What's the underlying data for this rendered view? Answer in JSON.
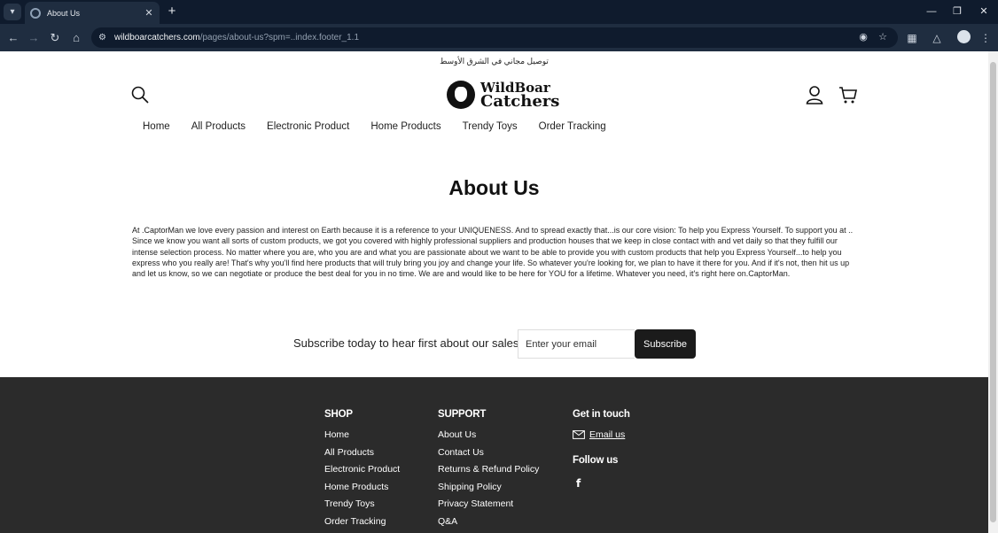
{
  "browser": {
    "tab_title": "About Us",
    "url_host": "wildboarcatchers.com",
    "url_path": "/pages/about-us?spm=..index.footer_1.1"
  },
  "announcement": "توصيل مجاني في الشرق الأوسط",
  "logo": {
    "line1": "WildBoar",
    "line2": "Catchers"
  },
  "nav": {
    "items": [
      "Home",
      "All Products",
      "Electronic Product",
      "Home Products",
      "Trendy Toys",
      "Order Tracking"
    ]
  },
  "page": {
    "title": "About Us",
    "body": "At .CaptorMan we love every passion and interest on Earth because it is a reference to your UNIQUENESS. And to spread exactly that...is our core vision: To help you Express Yourself. To support you at .. Since we know you want all sorts of custom products, we got you covered with highly professional suppliers and production houses that we keep in close contact with and vet daily so that they fulfill our intense selection process. No matter where you are, who you are and what you are passionate about we want to be able to provide you with custom products that help you Express Yourself...to help you express who you really are! That's why you'll find here products that will truly bring you joy and change your life. So whatever you're looking for, we plan to have it there for you. And if it's not, then hit us up and let us know, so we can negotiate or produce the best deal for you in no time. We are and would like to be here for YOU for a lifetime. Whatever you need, it's right here on.CaptorMan."
  },
  "subscribe": {
    "label": "Subscribe today to hear first about our sales",
    "placeholder": "Enter your email",
    "button": "Subscribe"
  },
  "footer": {
    "shop": {
      "heading": "SHOP",
      "links": [
        "Home",
        "All Products",
        "Electronic Product",
        "Home Products",
        "Trendy Toys",
        "Order Tracking"
      ]
    },
    "support": {
      "heading": "SUPPORT",
      "links": [
        "About Us",
        "Contact Us",
        "Returns & Refund Policy",
        "Shipping Policy",
        "Privacy Statement",
        "Q&A"
      ]
    },
    "contact": {
      "heading": "Get in touch",
      "email_label": "Email us",
      "follow_heading": "Follow us",
      "social_icon": "facebook-icon"
    }
  },
  "colors": {
    "footer_bg": "#2b2b2b",
    "button_bg": "#1b1b1b",
    "chrome_bg": "#1f2d40"
  }
}
